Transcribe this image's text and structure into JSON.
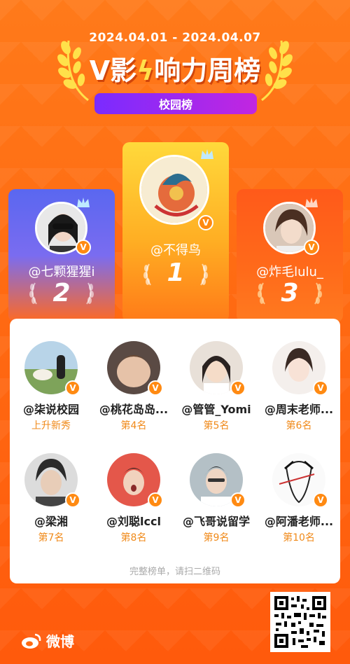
{
  "header": {
    "date_range": "2024.04.01 - 2024.04.07",
    "title_prefix": "V影",
    "title_bolt": "",
    "title_suffix": "响力周榜",
    "tag": "校园榜"
  },
  "podium": [
    {
      "rank": "2",
      "name": "@七颗猩猩i",
      "badge": "V",
      "avatar_color": "#c9c9c9"
    },
    {
      "rank": "1",
      "name": "@不得鸟",
      "badge": "V",
      "avatar_color": "#f5e8c8"
    },
    {
      "rank": "3",
      "name": "@炸毛lulu_",
      "badge": "V",
      "avatar_color": "#d8b7a0"
    }
  ],
  "list": [
    {
      "name": "@柒说校园",
      "rank_label": "上升新秀",
      "badge": "V",
      "avatar_color": "#8fb27a"
    },
    {
      "name": "@桃花岛岛...",
      "rank_label": "第4名",
      "badge": "V",
      "avatar_color": "#c4a890"
    },
    {
      "name": "@管管_Yomi",
      "rank_label": "第5名",
      "badge": "V",
      "avatar_color": "#e6d4c6"
    },
    {
      "name": "@周末老师...",
      "rank_label": "第6名",
      "badge": "V",
      "avatar_color": "#efe7e3"
    },
    {
      "name": "@梁湘",
      "rank_label": "第7名",
      "badge": "V",
      "avatar_color": "#bfbfbf"
    },
    {
      "name": "@刘聪lccl",
      "rank_label": "第8名",
      "badge": "V",
      "avatar_color": "#d96a5a"
    },
    {
      "name": "@飞哥说留学",
      "rank_label": "第9名",
      "badge": "V",
      "avatar_color": "#9fb0b8"
    },
    {
      "name": "@阿潘老师...",
      "rank_label": "第10名",
      "badge": "V",
      "avatar_color": "#f2f2f2"
    }
  ],
  "footer_text": "完整榜单，请扫二维码",
  "brand": "微博",
  "icons": {
    "badge": "verified-v-icon",
    "crown": "crown-icon",
    "laurel": "laurel-icon",
    "qr": "qr-code"
  },
  "colors": {
    "accent": "#ff7a1a",
    "tag": "#a52ae8",
    "rank_text": "#f08a1a"
  }
}
